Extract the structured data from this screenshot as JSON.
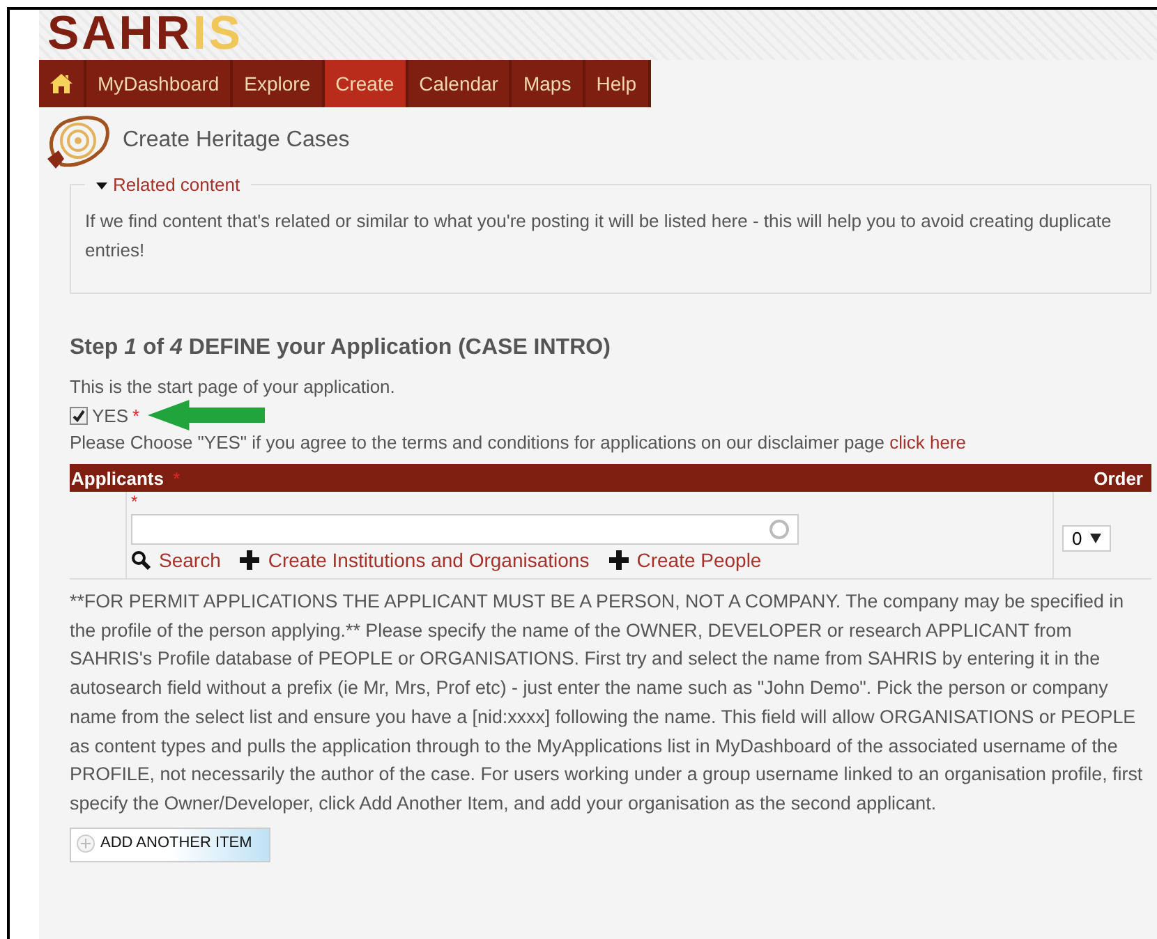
{
  "logo": {
    "main": "SAHR",
    "accent": "IS"
  },
  "nav": [
    {
      "kind": "home",
      "selected": false
    },
    {
      "kind": "text",
      "label": "MyDashboard",
      "selected": false
    },
    {
      "kind": "text",
      "label": "Explore",
      "selected": false
    },
    {
      "kind": "text",
      "label": "Create",
      "selected": true
    },
    {
      "kind": "text",
      "label": "Calendar",
      "selected": false
    },
    {
      "kind": "text",
      "label": "Maps",
      "selected": false
    },
    {
      "kind": "text",
      "label": "Help",
      "selected": false
    }
  ],
  "page_title": "Create Heritage Cases",
  "related": {
    "legend": "Related content",
    "expanded": true,
    "text": "If we find content that's related or similar to what you're posting it will be listed here - this will help you to avoid creating duplicate entries!"
  },
  "step_heading": "Step *1* of *4* DEFINE your Application (CASE INTRO)",
  "intro": "This is the start page of your application.",
  "agree": {
    "label": "YES",
    "required": "*",
    "checked": true
  },
  "disclaimer": {
    "text": "Please Choose \"YES\" if you agree to the terms and conditions for applications on our disclaimer page",
    "link": "click here"
  },
  "applicants": {
    "columns": [
      {
        "label": "Applicants",
        "required": "*"
      },
      {
        "label": "Order"
      }
    ],
    "row": {
      "required": "*",
      "order": "0",
      "links": [
        {
          "kind": "search",
          "label": "Search"
        },
        {
          "kind": "plus",
          "label": "Create Institutions and Organisations"
        },
        {
          "kind": "plus",
          "label": "Create People"
        }
      ]
    }
  },
  "help_text": "**FOR PERMIT APPLICATIONS THE APPLICANT MUST BE A PERSON, NOT A COMPANY. The company may be specified in the profile of the person applying.** Please specify the name of the OWNER, DEVELOPER or research APPLICANT from SAHRIS's Profile database of PEOPLE or ORGANISATIONS. First try and select the name from SAHRIS by entering it in the autosearch field without a prefix (ie Mr, Mrs, Prof etc) - just enter the name such as \"John Demo\". Pick the person or company name from the select list and ensure you have a [nid:xxxx] following the name. This field will allow ORGANISATIONS or PEOPLE as content types and pulls the application through to the MyApplications list in MyDashboard of the associated username of the PROFILE, not necessarily the author of the case. For users working under a group username linked to an organisation profile, first specify the Owner/Developer, click Add Another Item, and add your organisation as the second applicant.",
  "add_button": "ADD ANOTHER ITEM"
}
